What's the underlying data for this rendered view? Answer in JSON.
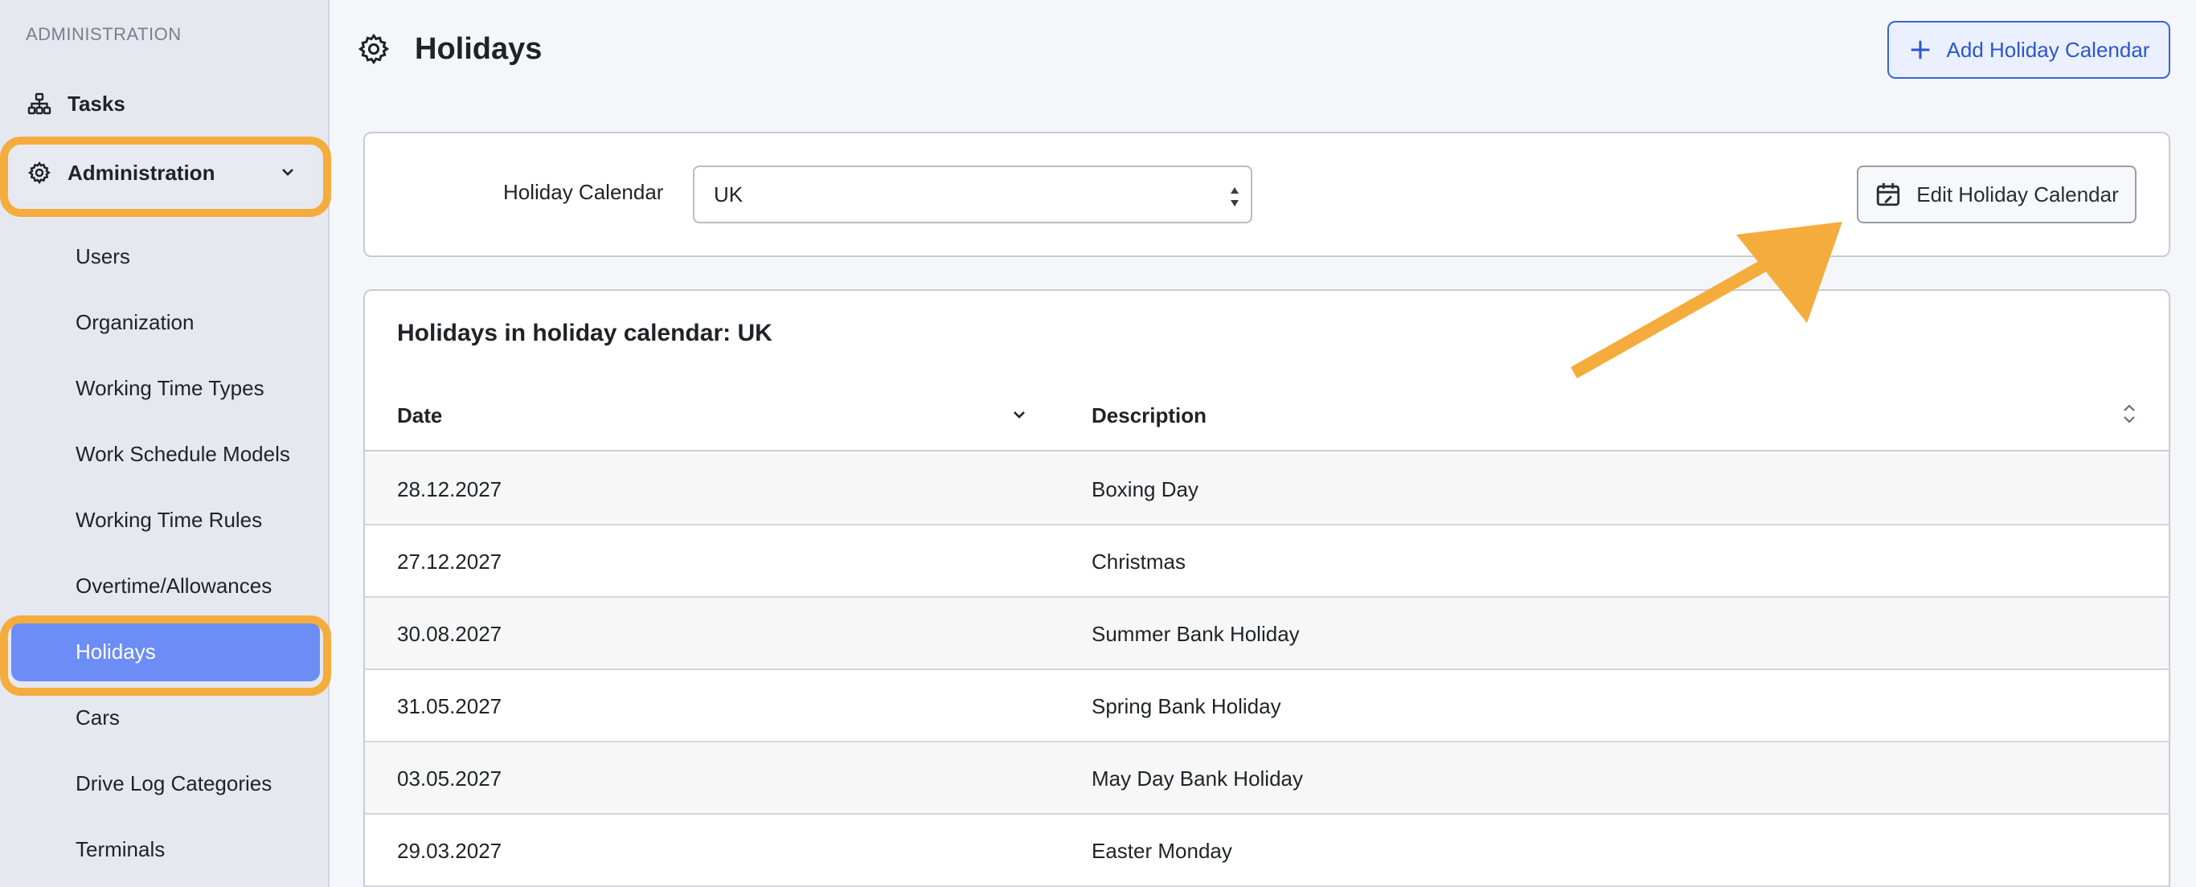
{
  "sidebar": {
    "section_label": "ADMINISTRATION",
    "tasks_label": "Tasks",
    "admin_label": "Administration",
    "items": [
      {
        "label": "Users"
      },
      {
        "label": "Organization"
      },
      {
        "label": "Working Time Types"
      },
      {
        "label": "Work Schedule Models"
      },
      {
        "label": "Working Time Rules"
      },
      {
        "label": "Overtime/Allowances"
      },
      {
        "label": "Holidays",
        "active": true
      },
      {
        "label": "Cars"
      },
      {
        "label": "Drive Log Categories"
      },
      {
        "label": "Terminals"
      }
    ]
  },
  "header": {
    "title": "Holidays",
    "add_button_label": "Add Holiday Calendar"
  },
  "filter": {
    "label": "Holiday Calendar",
    "selected": "UK",
    "edit_button_label": "Edit Holiday Calendar"
  },
  "table": {
    "title": "Holidays in holiday calendar: UK",
    "columns": [
      "Date",
      "Description"
    ],
    "rows": [
      {
        "date": "28.12.2027",
        "description": "Boxing Day"
      },
      {
        "date": "27.12.2027",
        "description": "Christmas"
      },
      {
        "date": "30.08.2027",
        "description": "Summer Bank Holiday"
      },
      {
        "date": "31.05.2027",
        "description": "Spring Bank Holiday"
      },
      {
        "date": "03.05.2027",
        "description": "May Day Bank Holiday"
      },
      {
        "date": "29.03.2027",
        "description": "Easter Monday"
      }
    ]
  },
  "colors": {
    "highlight": "#f4ac3d",
    "active_nav": "#6c8df5",
    "primary": "#2b56cf"
  }
}
